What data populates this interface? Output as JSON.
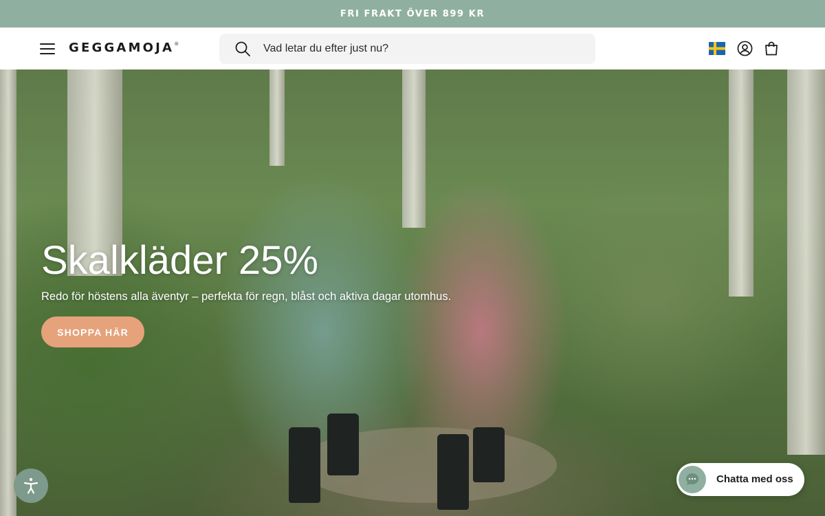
{
  "announcement": {
    "text": "FRI FRAKT ÖVER 899 KR"
  },
  "header": {
    "logo": "GEGGAMOJA",
    "logo_mark": "®",
    "search": {
      "placeholder": "Vad letar du efter just nu?",
      "value": ""
    },
    "icons": [
      "menu-icon",
      "search-icon",
      "sweden-flag-icon",
      "account-icon",
      "shopping-bag-icon"
    ]
  },
  "hero": {
    "title": "Skalkläder 25%",
    "subtitle": "Redo för höstens alla äventyr – perfekta för regn, blåst och aktiva dagar utomhus.",
    "cta_label": "SHOPPA HÄR"
  },
  "widgets": {
    "chat_label": "Chatta med oss",
    "chat_icon": "chat-bubble-icon",
    "accessibility_icon": "accessibility-icon"
  },
  "colors": {
    "announcement_bg": "#8fb0a1",
    "cta_bg": "#e6a27b",
    "accessibility_bg": "#7d9a8c",
    "search_bg": "#f3f3f3"
  }
}
